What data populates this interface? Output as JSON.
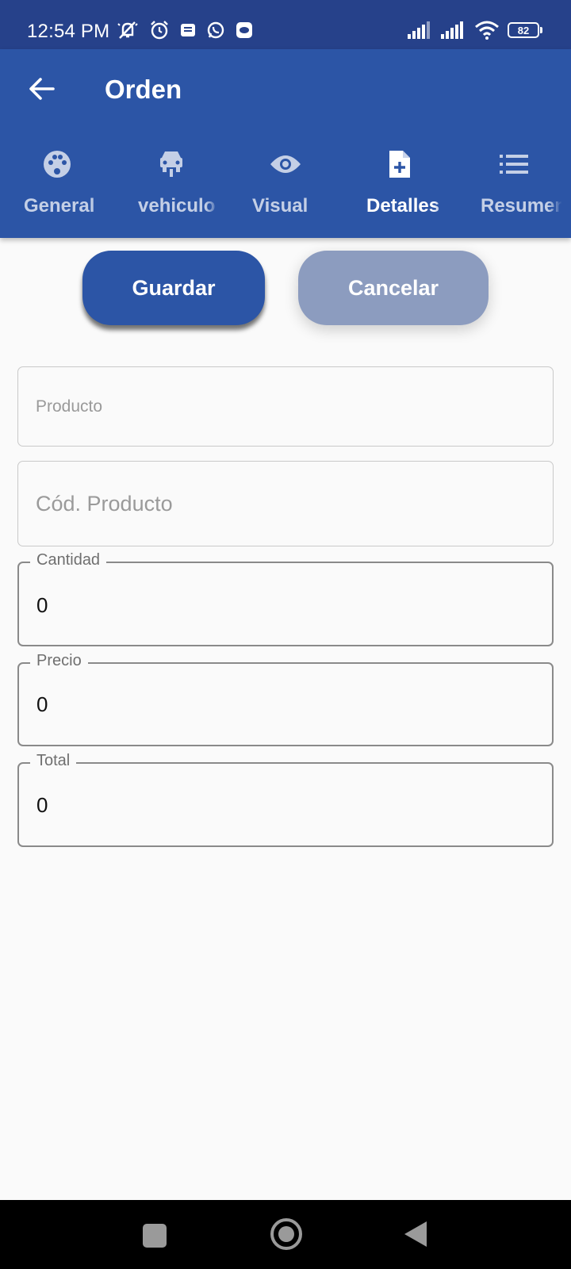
{
  "status_bar": {
    "time": "12:54 PM",
    "battery": "82",
    "left_icons": [
      "mute-notification-icon",
      "alarm-icon",
      "message-icon",
      "whatsapp-icon",
      "chat-icon"
    ],
    "right_icons": [
      "signal-icon",
      "signal-icon",
      "wifi-icon",
      "battery-icon"
    ]
  },
  "app_bar": {
    "title": "Orden",
    "back_icon": "arrow-left-icon"
  },
  "tabs": [
    {
      "label": "General",
      "icon": "palette-icon",
      "active": false
    },
    {
      "label": "vehiculo",
      "icon": "car-icon",
      "active": false
    },
    {
      "label": "Visual",
      "icon": "eye-icon",
      "active": false
    },
    {
      "label": "Detalles",
      "icon": "note-add-icon",
      "active": true
    },
    {
      "label": "Resumen",
      "icon": "list-icon",
      "active": false
    }
  ],
  "actions": {
    "save_label": "Guardar",
    "cancel_label": "Cancelar"
  },
  "form": {
    "producto": {
      "placeholder": "Producto"
    },
    "cod_producto": {
      "placeholder": "Cód. Producto"
    },
    "cantidad": {
      "label": "Cantidad",
      "value": "0"
    },
    "precio": {
      "label": "Precio",
      "value": "0"
    },
    "total": {
      "label": "Total",
      "value": "0"
    }
  },
  "colors": {
    "status_bar": "#26418a",
    "primary": "#2c55a6",
    "cancel_button": "#8c9cbf",
    "background": "#fafafa"
  }
}
